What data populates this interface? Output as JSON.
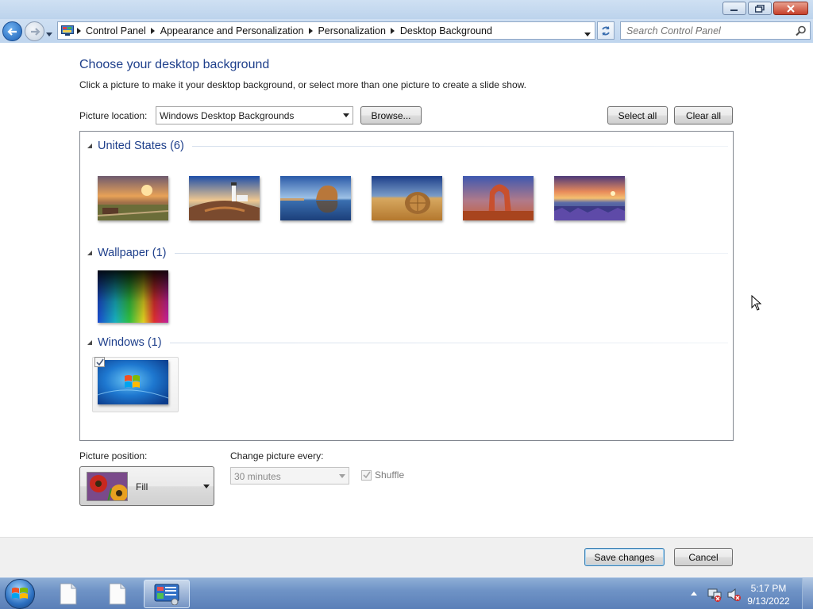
{
  "window": {
    "controls": {
      "minimize": "minimize-icon",
      "restore": "restore-icon",
      "close": "close-icon"
    }
  },
  "navigation": {
    "back_icon": "back-arrow-icon",
    "forward_icon": "forward-arrow-icon",
    "breadcrumbs": [
      "Control Panel",
      "Appearance and Personalization",
      "Personalization",
      "Desktop Background"
    ],
    "search_placeholder": "Search Control Panel"
  },
  "page": {
    "heading": "Choose your desktop background",
    "description": "Click a picture to make it your desktop background, or select more than one picture to create a slide show.",
    "picture_location_label": "Picture location:",
    "picture_location_value": "Windows Desktop Backgrounds",
    "browse_label": "Browse...",
    "select_all_label": "Select all",
    "clear_all_label": "Clear all"
  },
  "gallery": {
    "groups": [
      {
        "title": "United States (6)",
        "items": [
          "us-sunset-barn",
          "us-lighthouse",
          "us-rock-lake",
          "us-hay-bale",
          "us-arch",
          "us-lupine-lake"
        ]
      },
      {
        "title": "Wallpaper (1)",
        "items": [
          "wallpaper-rainbow"
        ]
      },
      {
        "title": "Windows (1)",
        "items": [
          "windows-7-default"
        ],
        "selected": [
          true
        ]
      }
    ]
  },
  "options": {
    "picture_position_label": "Picture position:",
    "picture_position_value": "Fill",
    "change_picture_label": "Change picture every:",
    "change_picture_value": "30 minutes",
    "shuffle_label": "Shuffle",
    "shuffle_checked": true,
    "shuffle_enabled": false
  },
  "footer": {
    "save_label": "Save changes",
    "cancel_label": "Cancel"
  },
  "taskbar": {
    "clock_time": "5:17 PM",
    "clock_date": "9/13/2022",
    "items": [
      "document-icon",
      "document-icon",
      "control-panel-icon"
    ]
  },
  "colors": {
    "heading_blue": "#1e3f8b",
    "title_bar": "#bcd3ec",
    "taskbar": "#6f93c6",
    "footer_bg": "#f0f0f0"
  }
}
